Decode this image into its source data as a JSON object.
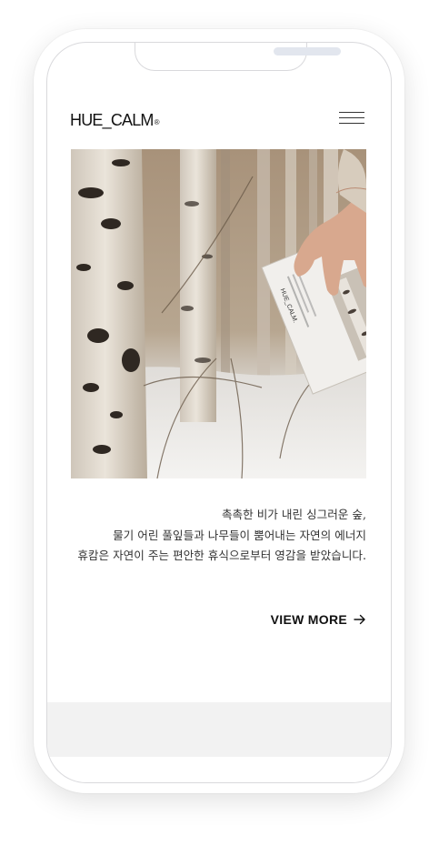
{
  "header": {
    "logo_text": "HUE_CALM",
    "logo_mark": "®",
    "menu_icon": "hamburger-menu-icon"
  },
  "hero": {
    "image_subject": "hand holding a birch-print product box in a snowy birch forest",
    "box_brand_text": "HUE_CALM."
  },
  "intro": {
    "line1": "촉촉한 비가 내린 싱그러운 숲,",
    "line2": "물기 어린 풀잎들과 나무들이 뿜어내는 자연의 에너지",
    "line3": "휴캄은 자연이 주는 편안한 휴식으로부터 영감을 받았습니다."
  },
  "cta": {
    "label": "VIEW MORE",
    "icon": "arrow-right-icon"
  },
  "colors": {
    "text": "#333333",
    "heading": "#111111",
    "footer_band": "#f2f2f2",
    "phone_outline": "#d9d9dc"
  }
}
